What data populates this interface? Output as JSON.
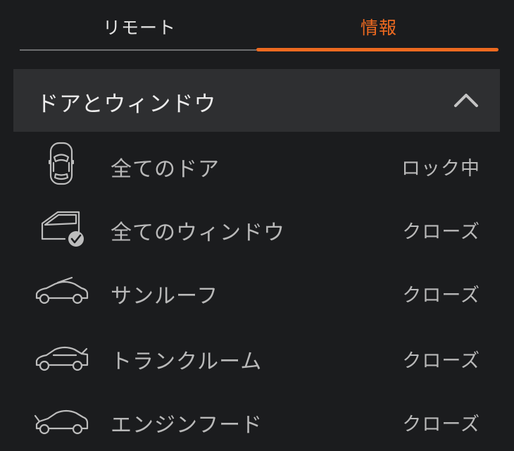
{
  "tabs": [
    {
      "label": "リモート",
      "active": false
    },
    {
      "label": "情報",
      "active": true
    }
  ],
  "colors": {
    "accent": "#ee6a20",
    "background": "#1b1c1e",
    "header_bg": "#2e2f31"
  },
  "section": {
    "title": "ドアとウィンドウ",
    "expanded": true,
    "toggle_icon": "chevron-up-icon"
  },
  "items": [
    {
      "label": "全てのドア",
      "value": "ロック中",
      "icon": "car-doors-icon"
    },
    {
      "label": "全てのウィンドウ",
      "value": "クローズ",
      "icon": "window-check-icon"
    },
    {
      "label": "サンルーフ",
      "value": "クローズ",
      "icon": "sunroof-icon"
    },
    {
      "label": "トランクルーム",
      "value": "クローズ",
      "icon": "trunk-icon"
    },
    {
      "label": "エンジンフード",
      "value": "クローズ",
      "icon": "hood-icon"
    }
  ]
}
